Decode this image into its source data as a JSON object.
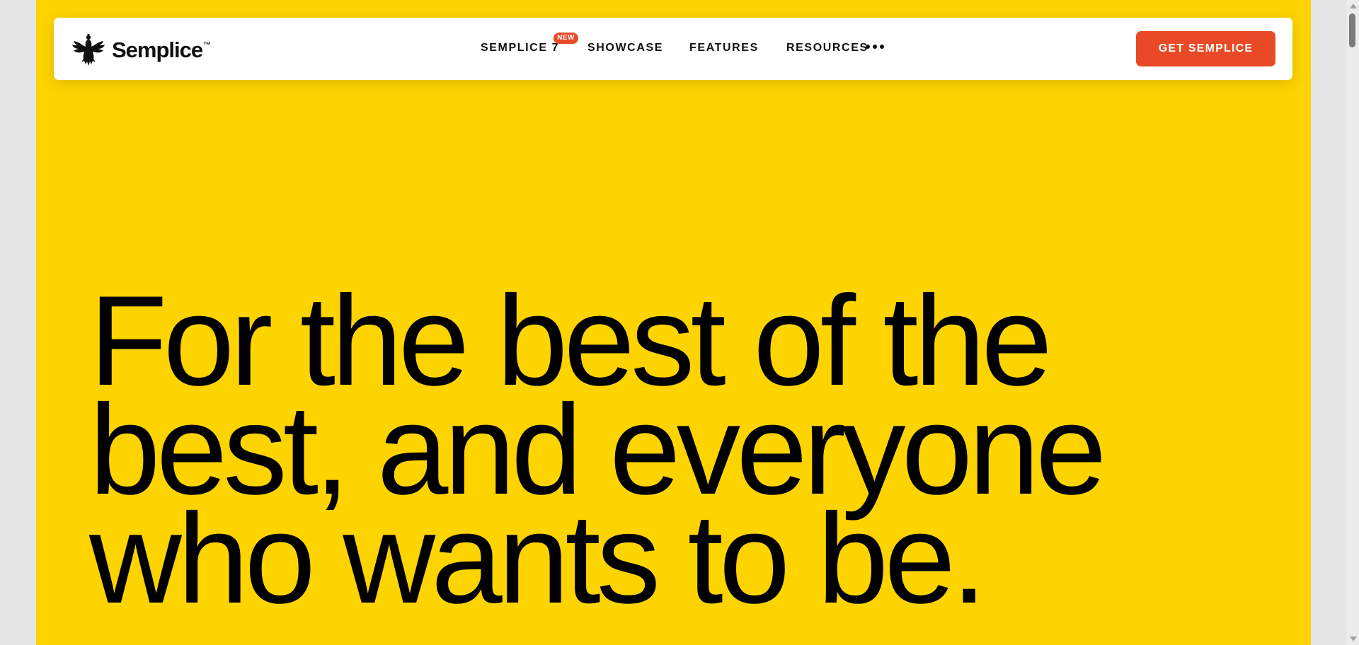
{
  "brand": {
    "name": "Semplice",
    "trademark": "™",
    "logo_icon": "eagle-crest-icon"
  },
  "nav": {
    "items": [
      {
        "label": "SEMPLICE 7",
        "badge": "NEW"
      },
      {
        "label": "SHOWCASE"
      },
      {
        "label": "FEATURES"
      },
      {
        "label": "RESOURCES"
      }
    ],
    "more_icon": "more-dots-icon",
    "cta_label": "GET SEMPLICE"
  },
  "hero": {
    "lines": [
      "For the best of the",
      "best, and everyone",
      "who wants to be."
    ]
  },
  "colors": {
    "page_background": "#fdd400",
    "accent": "#e84a27",
    "text": "#111111",
    "navbar": "#ffffff"
  }
}
